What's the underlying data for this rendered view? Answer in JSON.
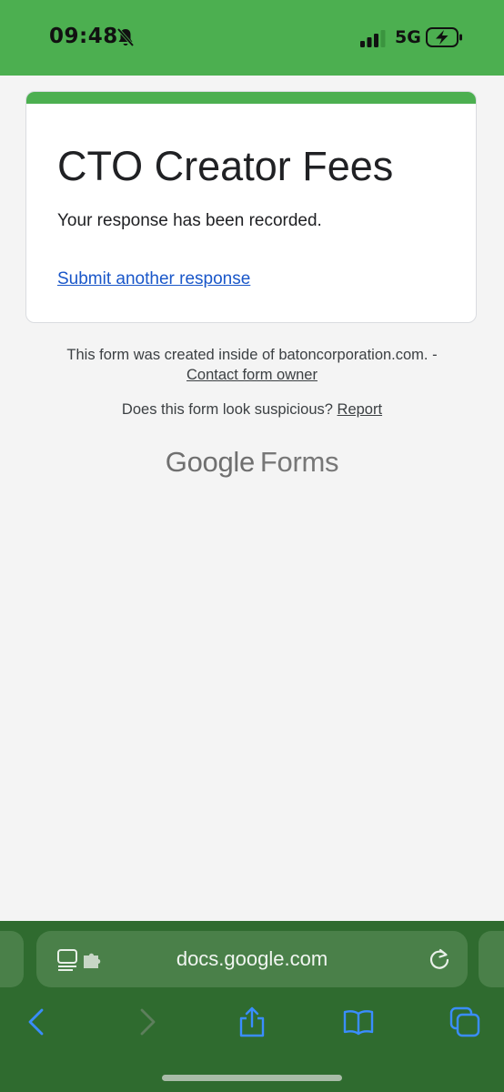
{
  "status_bar": {
    "time": "09:48",
    "network": "5G",
    "icons": [
      "bell-slash-icon",
      "signal-bars-icon",
      "battery-charging-icon"
    ]
  },
  "form": {
    "title": "CTO Creator Fees",
    "confirmation_message": "Your response has been recorded.",
    "submit_another_link": "Submit another response",
    "accent_color": "#4caf50"
  },
  "footer": {
    "created_inside": "This form was created inside of batoncorporation.com. -",
    "contact_owner_link": "Contact form owner",
    "suspicious_text": "Does this form look suspicious?",
    "report_link": "Report",
    "logo_google": "Google",
    "logo_forms": "Forms"
  },
  "browser": {
    "url": "docs.google.com",
    "toolbar_color": "#2f6b2f",
    "icons": [
      "reader-extension-icon",
      "reload-icon",
      "back-icon",
      "forward-icon",
      "share-icon",
      "bookmarks-icon",
      "tabs-icon"
    ]
  }
}
